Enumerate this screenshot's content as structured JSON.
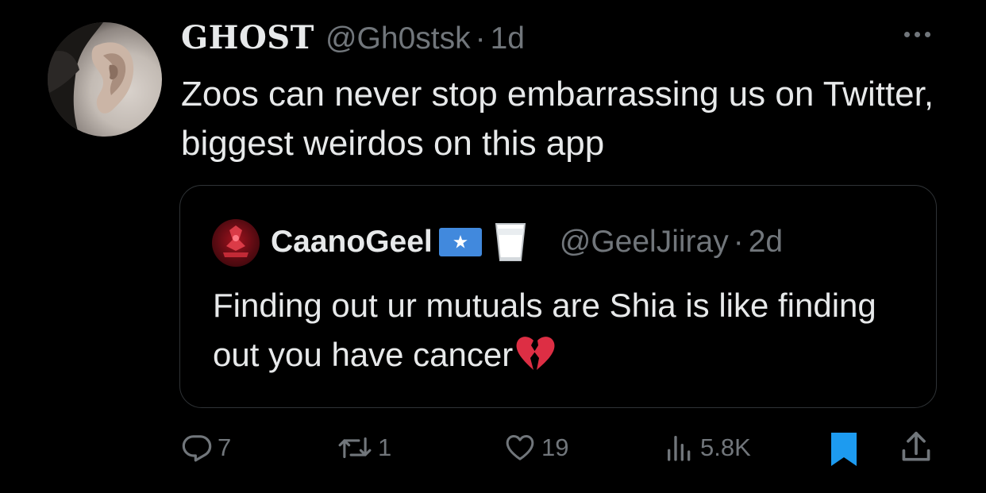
{
  "tweet": {
    "display_name": "GHOST",
    "handle": "@Gh0stsk",
    "separator": "·",
    "time": "1d",
    "text": "Zoos can never stop embarrassing us on Twitter, biggest weirdos on this app",
    "more_icon": "more-horizontal-icon"
  },
  "quote": {
    "display_name": "CaanoGeel",
    "handle": "@GeelJiiray",
    "separator": "·",
    "time": "2d",
    "text": "Finding out ur mutuals are Shia is like finding out you have cancer",
    "flag_icon": "somalia-flag-icon",
    "emoji_icon": "milk-glass-icon",
    "trailing_emoji": "broken-heart-icon"
  },
  "actions": {
    "reply_count": "7",
    "retweet_count": "1",
    "like_count": "19",
    "views_count": "5.8K",
    "bookmark_active": true
  },
  "colors": {
    "background": "#000000",
    "text_primary": "#e7e9ea",
    "text_secondary": "#71767b",
    "border": "#2f3336",
    "bookmark_accent": "#1d9bf0",
    "somalia_blue": "#4189dd",
    "broken_heart": "#dd2e44"
  }
}
